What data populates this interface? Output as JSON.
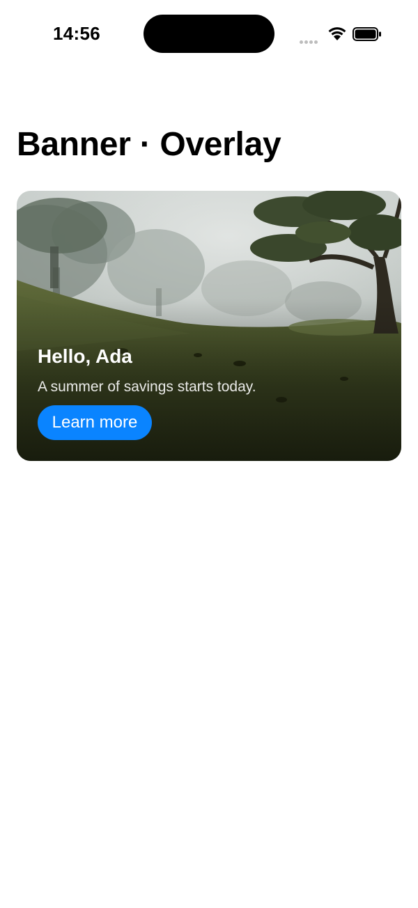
{
  "status_bar": {
    "time": "14:56",
    "icons": [
      "cellular-signal-icon",
      "wifi-icon",
      "battery-icon"
    ]
  },
  "page": {
    "title": "Banner · Overlay"
  },
  "banner": {
    "image": "foggy-forest-hillside-photo",
    "heading": "Hello, Ada",
    "subtitle": "A summer of savings starts today.",
    "button_label": "Learn more"
  },
  "colors": {
    "accent": "#0a84ff",
    "background": "#ffffff",
    "title_text": "#000000",
    "banner_text": "#ffffff"
  }
}
